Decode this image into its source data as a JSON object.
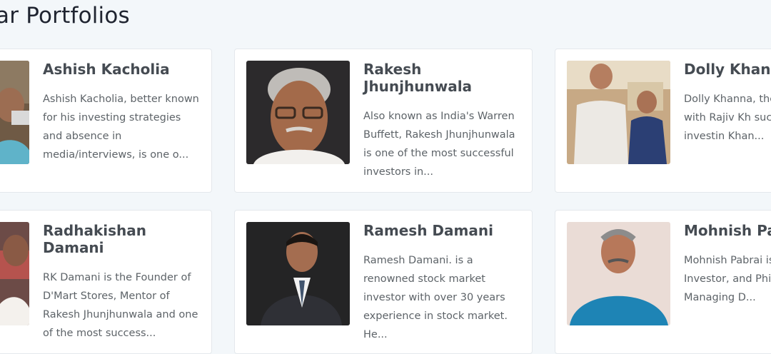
{
  "section": {
    "title": "ar Portfolios"
  },
  "cards": [
    {
      "name": "Ashish Kacholia",
      "description": "Ashish Kacholia, better known for his investing strategies and absence in media/interviews, is one o..."
    },
    {
      "name": "Rakesh Jhunjhunwala",
      "description": "Also known as India's Warren Buffett, Rakesh Jhunjhunwala is one of the most successful investors in..."
    },
    {
      "name": "Dolly Khanna",
      "description": "Dolly Khanna, the m along with Rajiv Kh successful investin Khan..."
    },
    {
      "name": "Radhakishan Damani",
      "description": "RK Damani is the Founder of D'Mart Stores, Mentor of Rakesh Jhunjhunwala and one of the most success..."
    },
    {
      "name": "Ramesh Damani",
      "description": "Ramesh Damani. is a renowned stock market investor with over 30 years experience in stock market. He..."
    },
    {
      "name": "Mohnish Pabrai",
      "description": "Mohnish Pabrai is a American Investor, and Philanthropist Managing D..."
    }
  ]
}
